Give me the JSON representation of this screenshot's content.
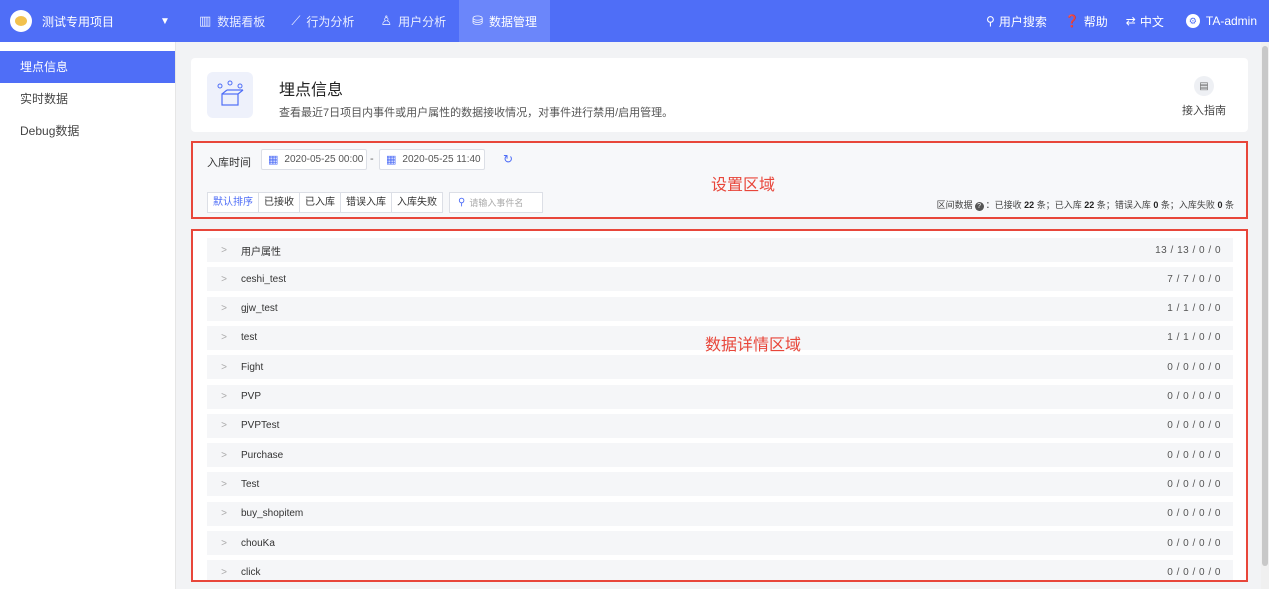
{
  "topbar": {
    "project": "测试专用项目",
    "tabs": [
      {
        "label": "数据看板",
        "icon": "dashboard-icon",
        "glyph": "▥"
      },
      {
        "label": "行为分析",
        "icon": "trend-icon",
        "glyph": "⟋"
      },
      {
        "label": "用户分析",
        "icon": "user-icon",
        "glyph": "♙"
      },
      {
        "label": "数据管理",
        "icon": "database-icon",
        "glyph": "⛁"
      }
    ],
    "user_search": "用户搜索",
    "help": "帮助",
    "language": "中文",
    "admin": "TA-admin"
  },
  "sidebar": {
    "items": [
      {
        "label": "埋点信息"
      },
      {
        "label": "实时数据"
      },
      {
        "label": "Debug数据"
      }
    ]
  },
  "header": {
    "title": "埋点信息",
    "description": "查看最近7日项目内事件或用户属性的数据接收情况，对事件进行禁用/启用管理。",
    "guide": "接入指南"
  },
  "settings": {
    "time_label": "入库时间",
    "start_date": "2020-05-25 00:00",
    "end_date": "2020-05-25 11:40",
    "sort_buttons": [
      "默认排序",
      "已接收",
      "已入库",
      "错误入库",
      "入库失败"
    ],
    "search_placeholder": "请输入事件名",
    "overlay_title": "设置区域",
    "stats": {
      "prefix": "区间数据",
      "received_label": "已接收",
      "received": "22",
      "stored_label": "已入库",
      "stored": "22",
      "error_label": "错误入库",
      "error": "0",
      "failed_label": "入库失败",
      "failed": "0",
      "unit": "条"
    }
  },
  "detail": {
    "overlay_title": "数据详情区域",
    "rows": [
      {
        "name": "用户属性",
        "counts": "13 / 13 / 0 / 0"
      },
      {
        "name": "ceshi_test",
        "counts": "7 / 7 / 0 / 0"
      },
      {
        "name": "gjw_test",
        "counts": "1 / 1 / 0 / 0"
      },
      {
        "name": "test",
        "counts": "1 / 1 / 0 / 0"
      },
      {
        "name": "Fight",
        "counts": "0 / 0 / 0 / 0"
      },
      {
        "name": "PVP",
        "counts": "0 / 0 / 0 / 0"
      },
      {
        "name": "PVPTest",
        "counts": "0 / 0 / 0 / 0"
      },
      {
        "name": "Purchase",
        "counts": "0 / 0 / 0 / 0"
      },
      {
        "name": "Test",
        "counts": "0 / 0 / 0 / 0"
      },
      {
        "name": "buy_shopitem",
        "counts": "0 / 0 / 0 / 0"
      },
      {
        "name": "chouKa",
        "counts": "0 / 0 / 0 / 0"
      },
      {
        "name": "click",
        "counts": "0 / 0 / 0 / 0"
      }
    ]
  }
}
